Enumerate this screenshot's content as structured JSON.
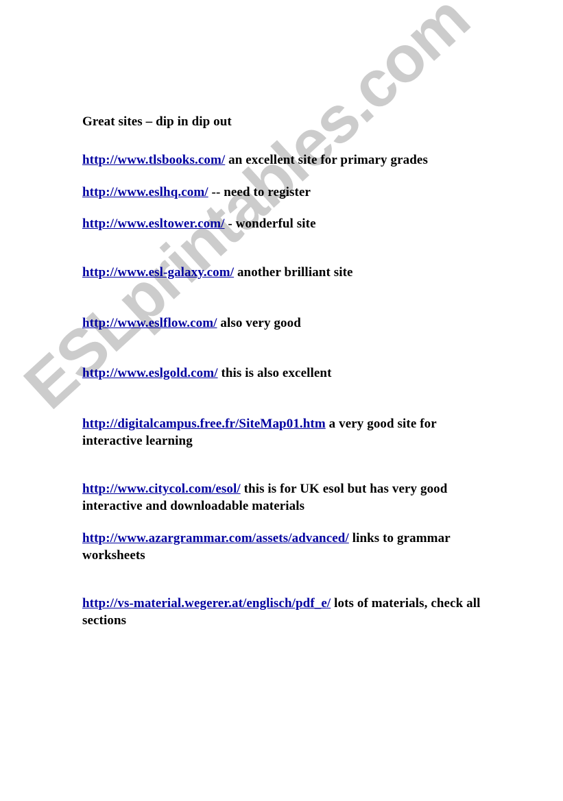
{
  "document": {
    "heading": "Great sites – dip in dip out",
    "watermark": {
      "text": "ESLprintables.com",
      "color": "#cccccc",
      "rotation_deg": -42.5
    },
    "link_color": "#0000a0",
    "text_color": "#000000",
    "background_color": "#ffffff",
    "entries": [
      {
        "url": "http://www.tlsbooks.com/",
        "note": " an excellent site for primary grades"
      },
      {
        "url": "http://www.eslhq.com/",
        "note": "   --  need to register"
      },
      {
        "url": "http://www.esltower.com/",
        "note": " -  wonderful site"
      },
      {
        "url": "http://www.esl-galaxy.com/",
        "note": "  another brilliant site"
      },
      {
        "url": "http://www.eslflow.com/",
        "note": "   also very good"
      },
      {
        "url": "http://www.eslgold.com/",
        "note": "  this is also excellent"
      },
      {
        "url": "http://digitalcampus.free.fr/SiteMap01.htm",
        "note": "  a very good site for interactive learning"
      },
      {
        "url": "http://www.citycol.com/esol/",
        "note": "  this is for UK esol but has very good interactive and downloadable materials"
      },
      {
        "url": "http://www.azargrammar.com/assets/advanced/",
        "note": " links to grammar worksheets"
      },
      {
        "url": "http://vs-material.wegerer.at/englisch/pdf_e/",
        "note": "  lots of materials, check all sections"
      }
    ]
  }
}
